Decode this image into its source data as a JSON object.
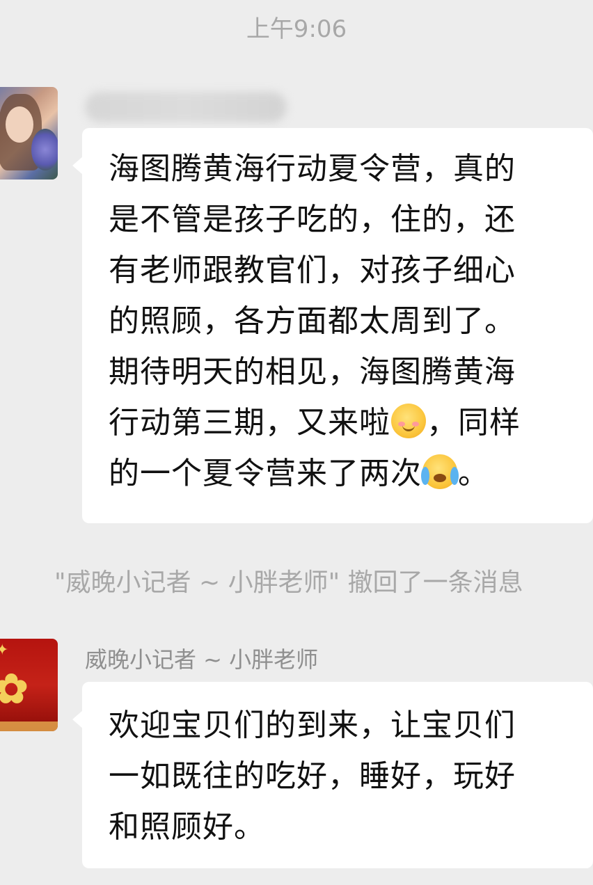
{
  "chat": {
    "timestamp": "上午9:06",
    "message1": {
      "line1": "海图腾黄海行动夏令营，真的",
      "line2": "是不管是孩子吃的，住的，还",
      "line3": "有老师跟教官们，对孩子细心",
      "line4": "的照顾，各方面都太周到了。",
      "line5": "期待明天的相见，海图腾黄海",
      "line6a": "行动第三期，又来啦",
      "line6b": "，同样",
      "line7a": "的一个夏令营来了两次",
      "line7b": "。",
      "emoji_a": "smiling-face-emoji",
      "emoji_b": "loudly-crying-face-emoji"
    },
    "recall_notice": "\"威晚小记者 ~ 小胖老师\" 撤回了一条消息",
    "message2": {
      "sender": "威晚小记者 ~ 小胖老师",
      "line1": "欢迎宝贝们的到来，让宝贝们",
      "line2": "一如既往的吃好，睡好，玩好",
      "line3": "和照顾好。"
    },
    "colors": {
      "background": "#ededed",
      "bubble": "#ffffff",
      "meta_text": "#a8a8a8"
    }
  }
}
